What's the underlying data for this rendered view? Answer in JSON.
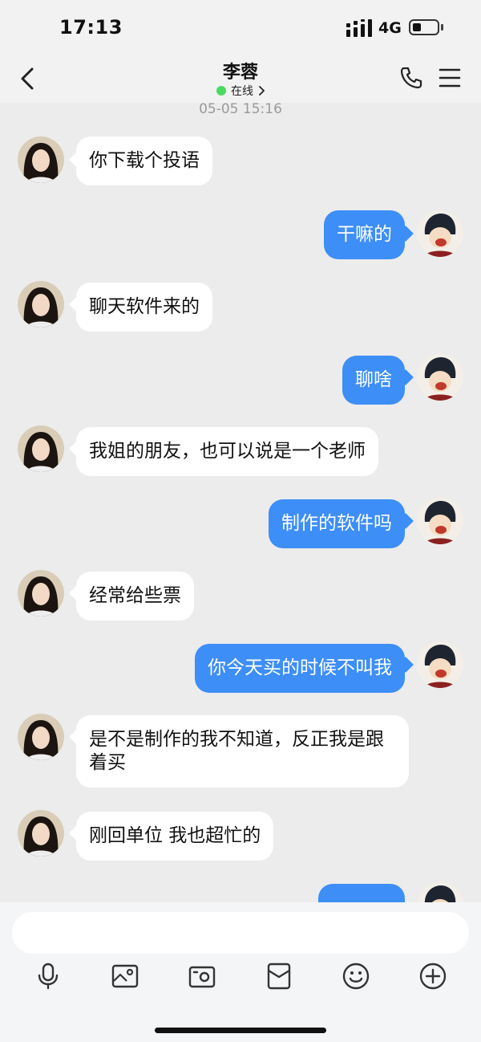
{
  "status_bar": {
    "time": "17:13",
    "network": "4G",
    "battery_level": 0.35
  },
  "header": {
    "contact_name": "李蓉",
    "presence": "在线"
  },
  "timestamp": "05-05 15:16",
  "messages": [
    {
      "from": "contact",
      "text": "你下载个投语"
    },
    {
      "from": "me",
      "text": "干嘛的"
    },
    {
      "from": "contact",
      "text": "聊天软件来的"
    },
    {
      "from": "me",
      "text": "聊啥"
    },
    {
      "from": "contact",
      "text": "我姐的朋友，也可以说是一个老师"
    },
    {
      "from": "me",
      "text": "制作的软件吗"
    },
    {
      "from": "contact",
      "text": "经常给些票"
    },
    {
      "from": "me",
      "text": "你今天买的时候不叫我"
    },
    {
      "from": "contact",
      "text": "是不是制作的我不知道，反正我是跟着买"
    },
    {
      "from": "contact",
      "text": "刚回单位 我也超忙的"
    }
  ],
  "input": {
    "value": "",
    "placeholder": ""
  },
  "toolbar": {
    "icons": [
      "microphone-icon",
      "image-icon",
      "camera-icon",
      "red-packet-icon",
      "emoji-icon",
      "plus-icon"
    ]
  },
  "colors": {
    "outgoing_bubble": "#3d8ef7",
    "incoming_bubble": "#ffffff",
    "online_dot": "#4cd964",
    "background": "#ececec"
  }
}
